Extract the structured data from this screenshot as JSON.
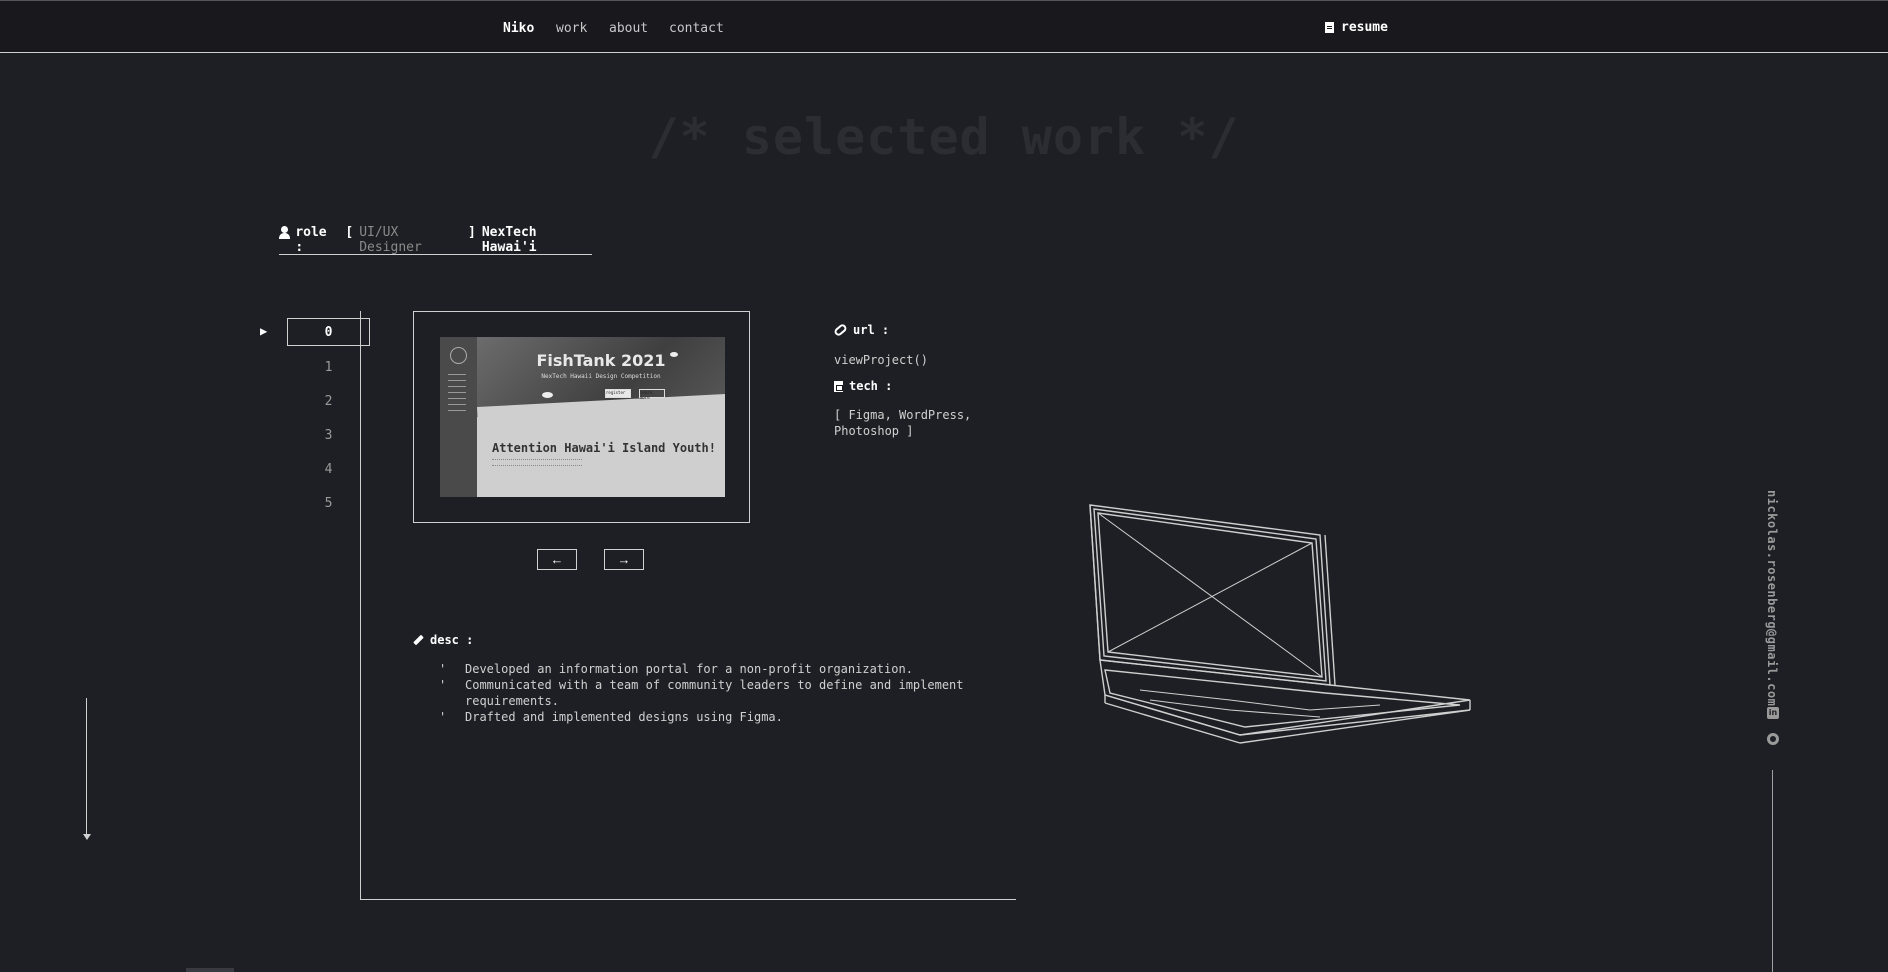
{
  "nav": {
    "brand": "Niko",
    "links": [
      "work",
      "about",
      "contact"
    ],
    "resume": "resume"
  },
  "heading": "/* selected work */",
  "role": {
    "label": "role :",
    "open_bracket": "[",
    "title": "UI/UX Designer",
    "close_bracket": "]",
    "company": "NexTech Hawai'i"
  },
  "index": {
    "marker": "▶",
    "items": [
      "0",
      "1",
      "2",
      "3",
      "4",
      "5"
    ],
    "active": "0"
  },
  "project_screenshot": {
    "title": "FishTank 2021",
    "subtitle": "NexTech Hawaii Design Competition",
    "button_primary": "register",
    "button_secondary": "learn more",
    "headline": "Attention Hawai'i Island Youth!"
  },
  "pager": {
    "prev": "←",
    "next": "→"
  },
  "info": {
    "url_label": "url :",
    "url_value": "viewProject()",
    "tech_label": "tech :",
    "tech_value_line1": "[ Figma, WordPress,",
    "tech_value_line2": "Photoshop ]"
  },
  "desc": {
    "label": "desc :",
    "items": [
      "Developed an information portal for a non-profit organization.",
      "Communicated with a team of community leaders to define and implement requirements.",
      "Drafted and implemented designs using Figma."
    ]
  },
  "sidebar": {
    "email": "nickolas.rosenberg@gmail.com",
    "linkedin_icon": "linkedin-icon",
    "github_icon": "github-icon"
  },
  "colors": {
    "background": "#1e1f24",
    "nav_background": "#18181d",
    "accent": "#ffffff",
    "muted": "#8a8a8a"
  }
}
